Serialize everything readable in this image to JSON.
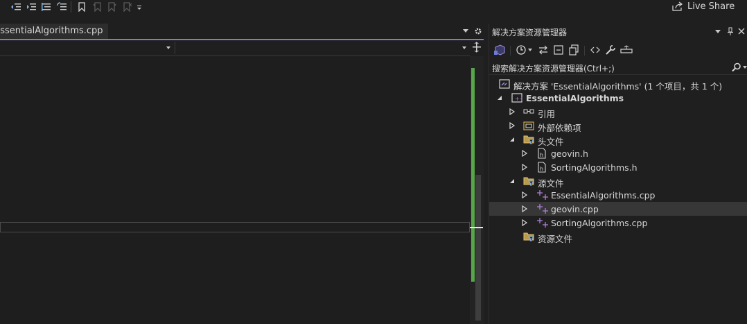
{
  "toolbar": {
    "live_share": "Live Share"
  },
  "editor": {
    "tab_title": "EssentialAlgorithms.cpp"
  },
  "solution_explorer": {
    "title": "解决方案资源管理器",
    "search_placeholder": "搜索解决方案资源管理器(Ctrl+;)",
    "tree": [
      {
        "label": "解决方案 'EssentialAlgorithms' (1 个项目，共 1 个)",
        "icon": "solution-icon"
      },
      {
        "label": "EssentialAlgorithms",
        "icon": "cpp-project-icon",
        "expanded": true
      },
      {
        "label": "引用",
        "icon": "references-icon",
        "expanded": false
      },
      {
        "label": "外部依赖项",
        "icon": "external-deps-icon",
        "expanded": false
      },
      {
        "label": "头文件",
        "icon": "filter-folder-icon",
        "expanded": true
      },
      {
        "label": "geovin.h",
        "icon": "header-file-icon",
        "expanded": false
      },
      {
        "label": "SortingAlgorithms.h",
        "icon": "header-file-icon",
        "expanded": false
      },
      {
        "label": "源文件",
        "icon": "filter-folder-icon",
        "expanded": true
      },
      {
        "label": "EssentialAlgorithms.cpp",
        "icon": "cpp-file-icon",
        "expanded": false
      },
      {
        "label": "geovin.cpp",
        "icon": "cpp-file-icon",
        "expanded": false,
        "selected": true
      },
      {
        "label": "SortingAlgorithms.cpp",
        "icon": "cpp-file-icon",
        "expanded": false
      },
      {
        "label": "资源文件",
        "icon": "filter-folder-icon"
      }
    ]
  },
  "colors": {
    "accent": "#8a75d6",
    "scroll_marker": "#57a64a",
    "cpp_icon": "#b180d7"
  }
}
